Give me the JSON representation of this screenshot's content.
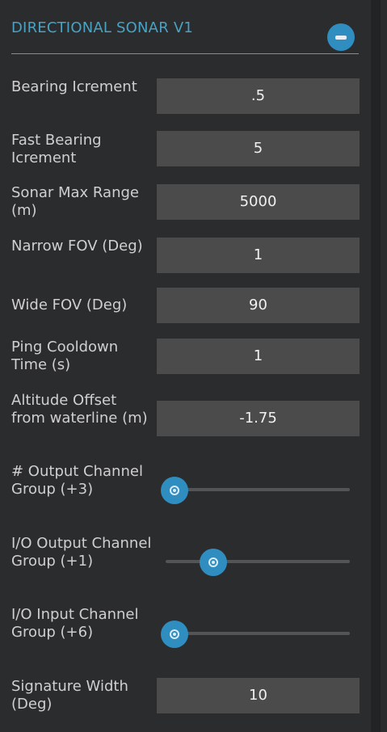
{
  "panel": {
    "title": "DIRECTIONAL SONAR V1",
    "collapse_icon": "minus-icon",
    "accent_color": "#48a2c4",
    "button_color": "#2f8dc0"
  },
  "fields": [
    {
      "label": "Bearing Icrement",
      "value": ".5"
    },
    {
      "label": "Fast Bearing Icrement",
      "value": "5"
    },
    {
      "label": "Sonar Max Range (m)",
      "value": "5000"
    },
    {
      "label": "Narrow FOV (Deg)",
      "value": "1"
    },
    {
      "label": "Wide FOV (Deg)",
      "value": "90"
    },
    {
      "label": "Ping Cooldown Time (s)",
      "value": "1"
    },
    {
      "label": "Altitude Offset from waterline (m)",
      "value": "-1.75"
    }
  ],
  "sliders": [
    {
      "label": "# Output Channel Group (+3)",
      "position": 0.0
    },
    {
      "label": "I/O Output Channel Group (+1)",
      "position": 0.2
    },
    {
      "label": "I/O Input Channel Group (+6)",
      "position": 0.0
    }
  ],
  "signature_width": {
    "label": "Signature Width (Deg)",
    "value": "10"
  }
}
